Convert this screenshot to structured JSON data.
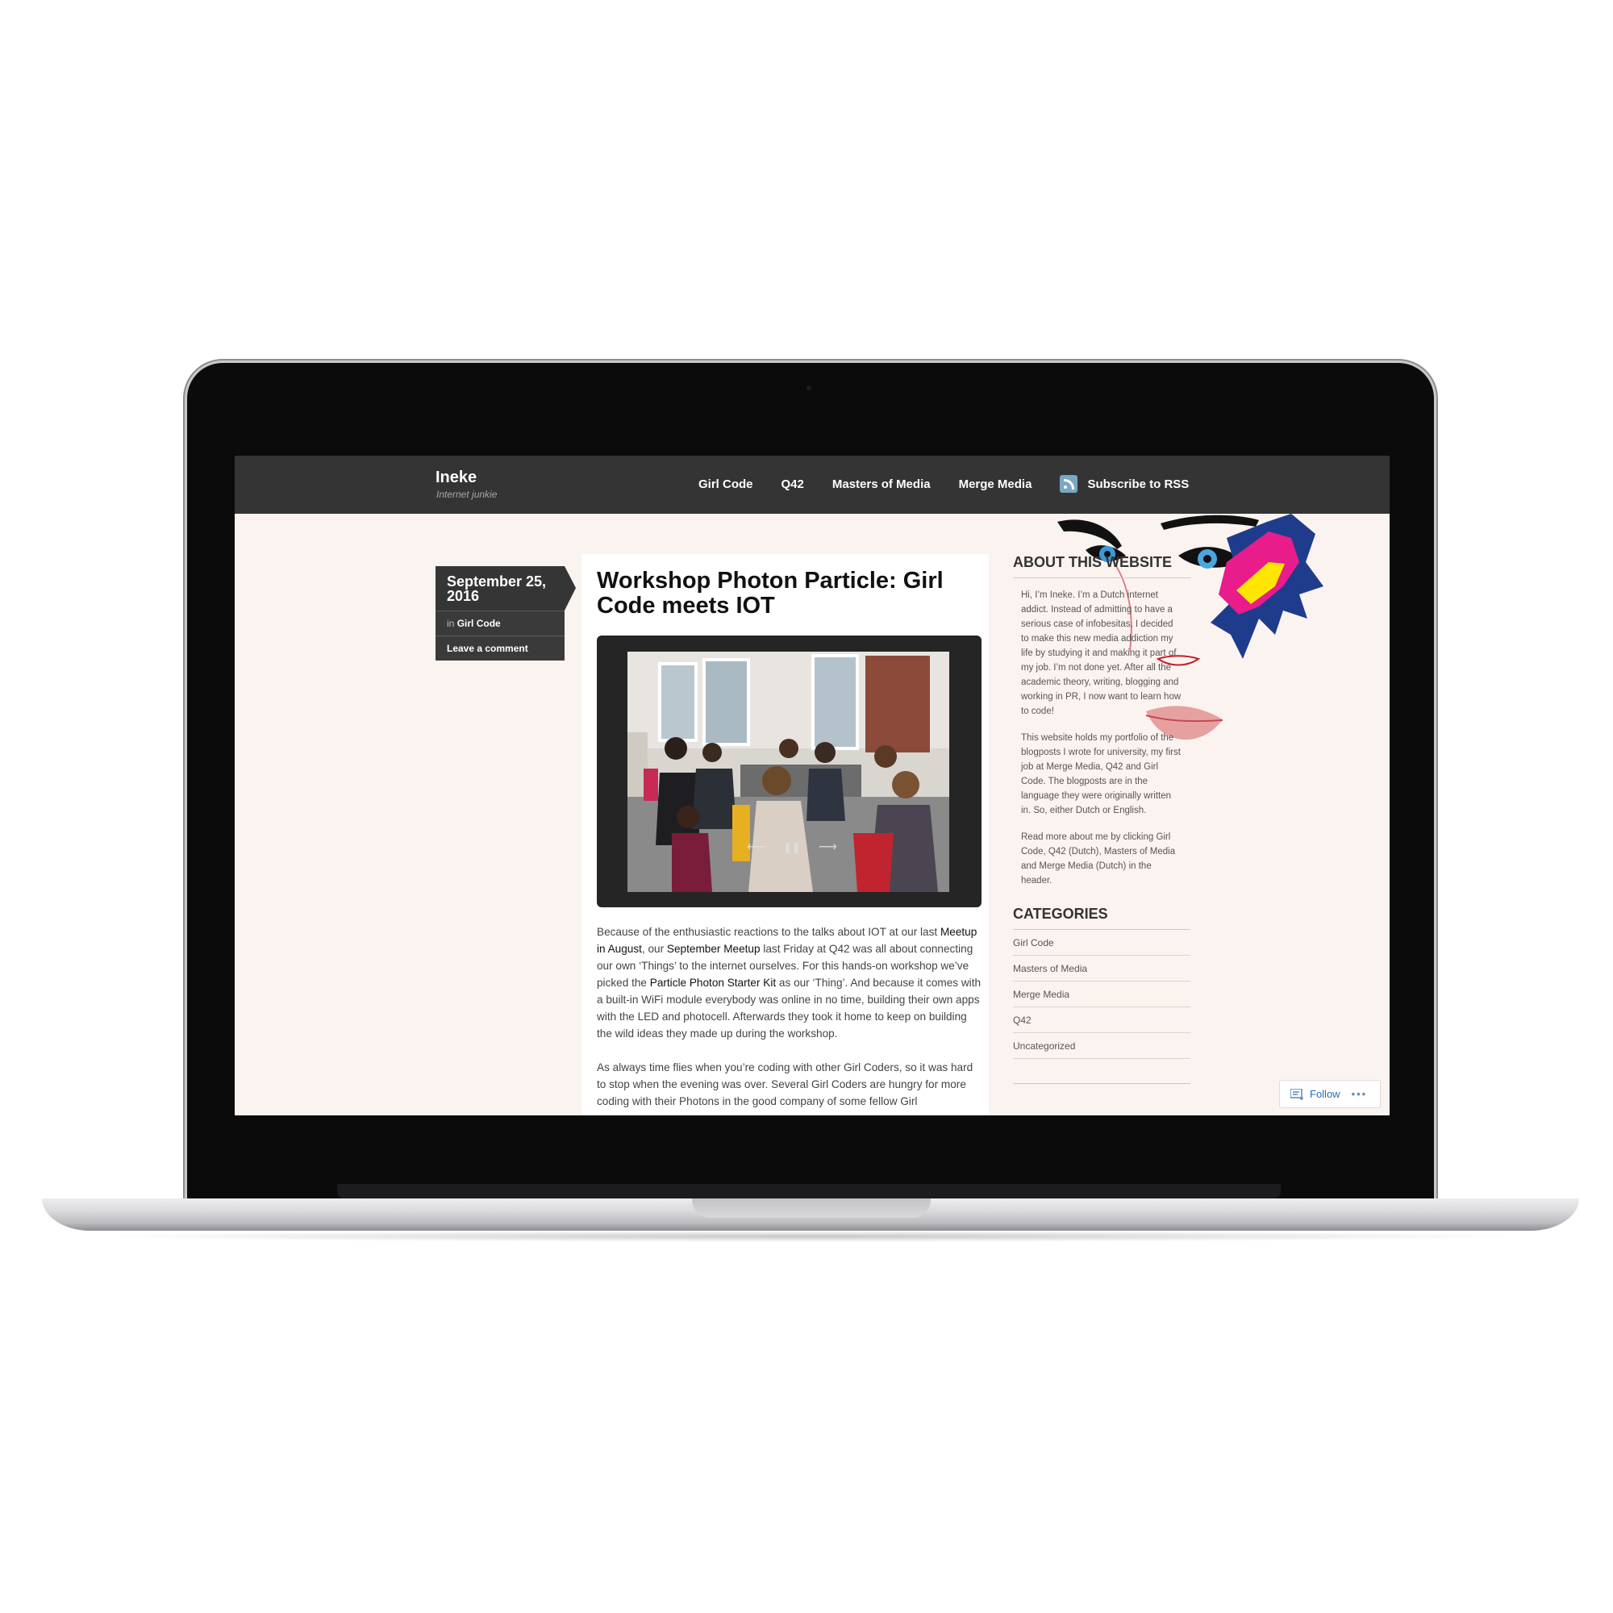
{
  "site": {
    "title": "Ineke",
    "tagline": "Internet junkie"
  },
  "nav": {
    "items": [
      "Girl Code",
      "Q42",
      "Masters of Media",
      "Merge Media"
    ],
    "rss_label": "Subscribe to RSS"
  },
  "post": {
    "date": "September 25, 2016",
    "category_prefix": "in",
    "category": "Girl Code",
    "comment_link": "Leave a comment",
    "title": "Workshop Photon Particle: Girl Code meets IOT",
    "p1": {
      "t1": "Because of the enthusiastic reactions to the talks about IOT at our last ",
      "l1": "Meetup in August",
      "t2": ", our ",
      "l2": "September Meetup",
      "t3": " last Friday at Q42 was all about connecting our own ‘Things’ to the internet ourselves. For this hands-on workshop we’ve picked the ",
      "l3": "Particle Photon Starter Kit",
      "t4": " as our ‘Thing’. And because it comes with a built-in WiFi module everybody was online in no time, building their own apps with the LED and photocell. Afterwards they took it home to keep on building the wild ideas they made up during the workshop."
    },
    "p2": "As always time flies when you’re coding with other Girl Coders, so it was hard to stop when the evening was over. Several Girl Coders are hungry for more coding with their Photons in the good company of some fellow Girl"
  },
  "gallery_controls": {
    "prev": "⟵",
    "pause": "❚❚",
    "next": "⟶"
  },
  "sidebar": {
    "about_title": "ABOUT THIS WEBSITE",
    "about_p1": "Hi, I’m Ineke. I’m a Dutch internet addict. Instead of admitting to have a serious case of infobesitas, I decided to make this new media addiction my life by studying it and making it part of my job. I’m not done yet. After all the academic theory, writing, blogging and working in PR, I now want to learn how to code!",
    "about_p2": "This website holds my portfolio of the blogposts I wrote for university, my first job at Merge Media, Q42 and Girl Code. The blogposts are in the language they were originally written in. So, either Dutch or English.",
    "about_p3": "Read more about me by clicking Girl Code, Q42 (Dutch), Masters of Media and Merge Media (Dutch) in the header.",
    "categories_title": "CATEGORIES",
    "categories": [
      "Girl Code",
      "Masters of Media",
      "Merge Media",
      "Q42",
      "Uncategorized"
    ]
  },
  "follow": {
    "label": "Follow",
    "more": "•••"
  },
  "colors": {
    "topbar": "#343434",
    "page_bg": "#fbf3ef",
    "rss": "#7aa7c6",
    "link_blue": "#2b6cb0"
  }
}
